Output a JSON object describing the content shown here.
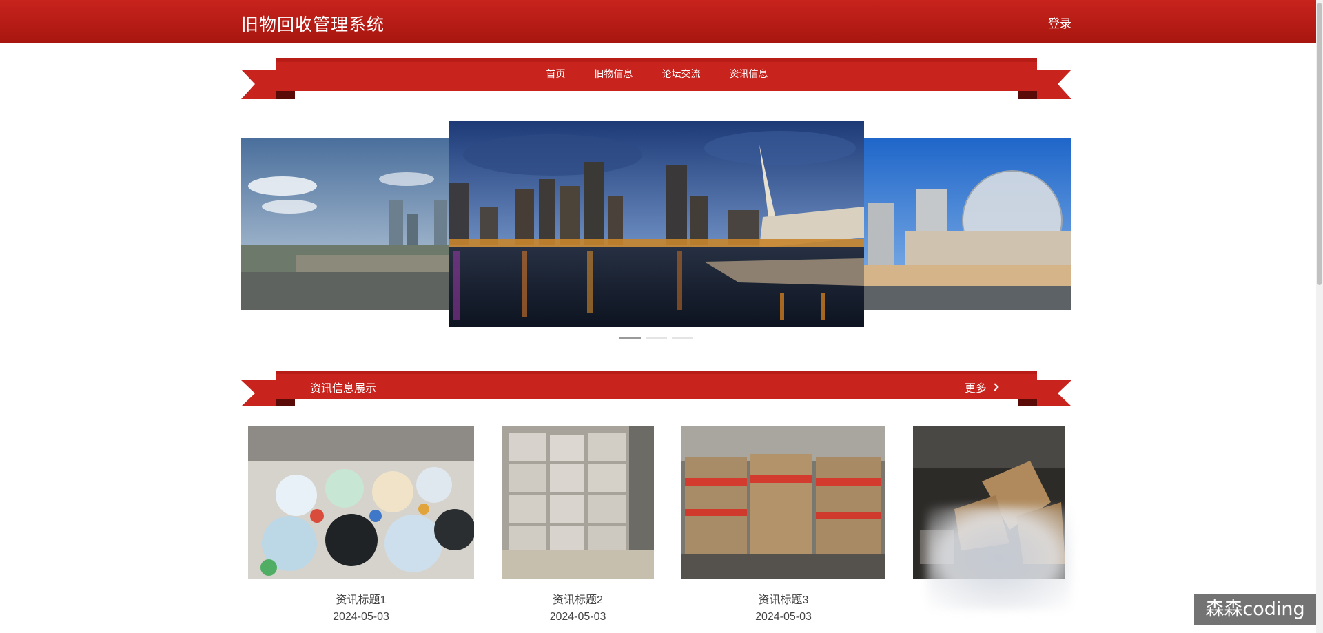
{
  "header": {
    "title": "旧物回收管理系统",
    "login_label": "登录"
  },
  "nav": {
    "items": [
      {
        "label": "首页"
      },
      {
        "label": "旧物信息"
      },
      {
        "label": "论坛交流"
      },
      {
        "label": "资讯信息"
      }
    ]
  },
  "carousel": {
    "active_index": 0,
    "slide_count": 3
  },
  "news_section": {
    "title": "资讯信息展示",
    "more_label": "更多",
    "items": [
      {
        "title": "资讯标题1",
        "date": "2024-05-03"
      },
      {
        "title": "资讯标题2",
        "date": "2024-05-03"
      },
      {
        "title": "资讯标题3",
        "date": "2024-05-03"
      }
    ]
  },
  "watermark": {
    "text": "森森coding"
  },
  "colors": {
    "brand_red": "#c8231d",
    "dark_red": "#a7160f",
    "ribbon_fold": "#7a0e0a"
  }
}
